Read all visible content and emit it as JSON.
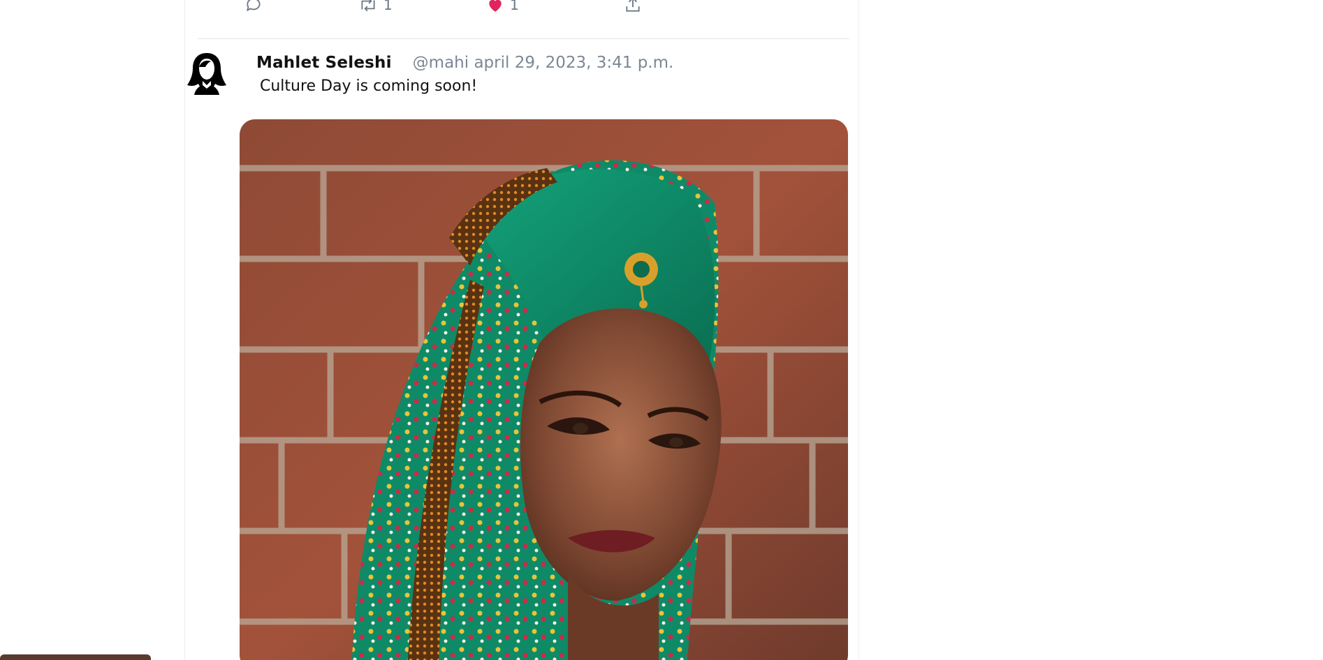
{
  "previous_tweet": {
    "actions": {
      "reply_count": "",
      "retweet_count": "1",
      "like_count": "1"
    }
  },
  "tweet": {
    "author_name": "Mahlet Seleshi",
    "handle_and_time": "@mahi april 29, 2023, 3:41 p.m.",
    "text": "Culture Day is coming soon!"
  },
  "colors": {
    "like_active": "#e0245e",
    "muted_text": "#7b8794",
    "media_scarf": "#0f8f6a",
    "media_brick": "#9a4a33"
  },
  "icons": {
    "reply": "reply-icon",
    "retweet": "retweet-icon",
    "like": "heart-icon",
    "share": "share-icon"
  }
}
